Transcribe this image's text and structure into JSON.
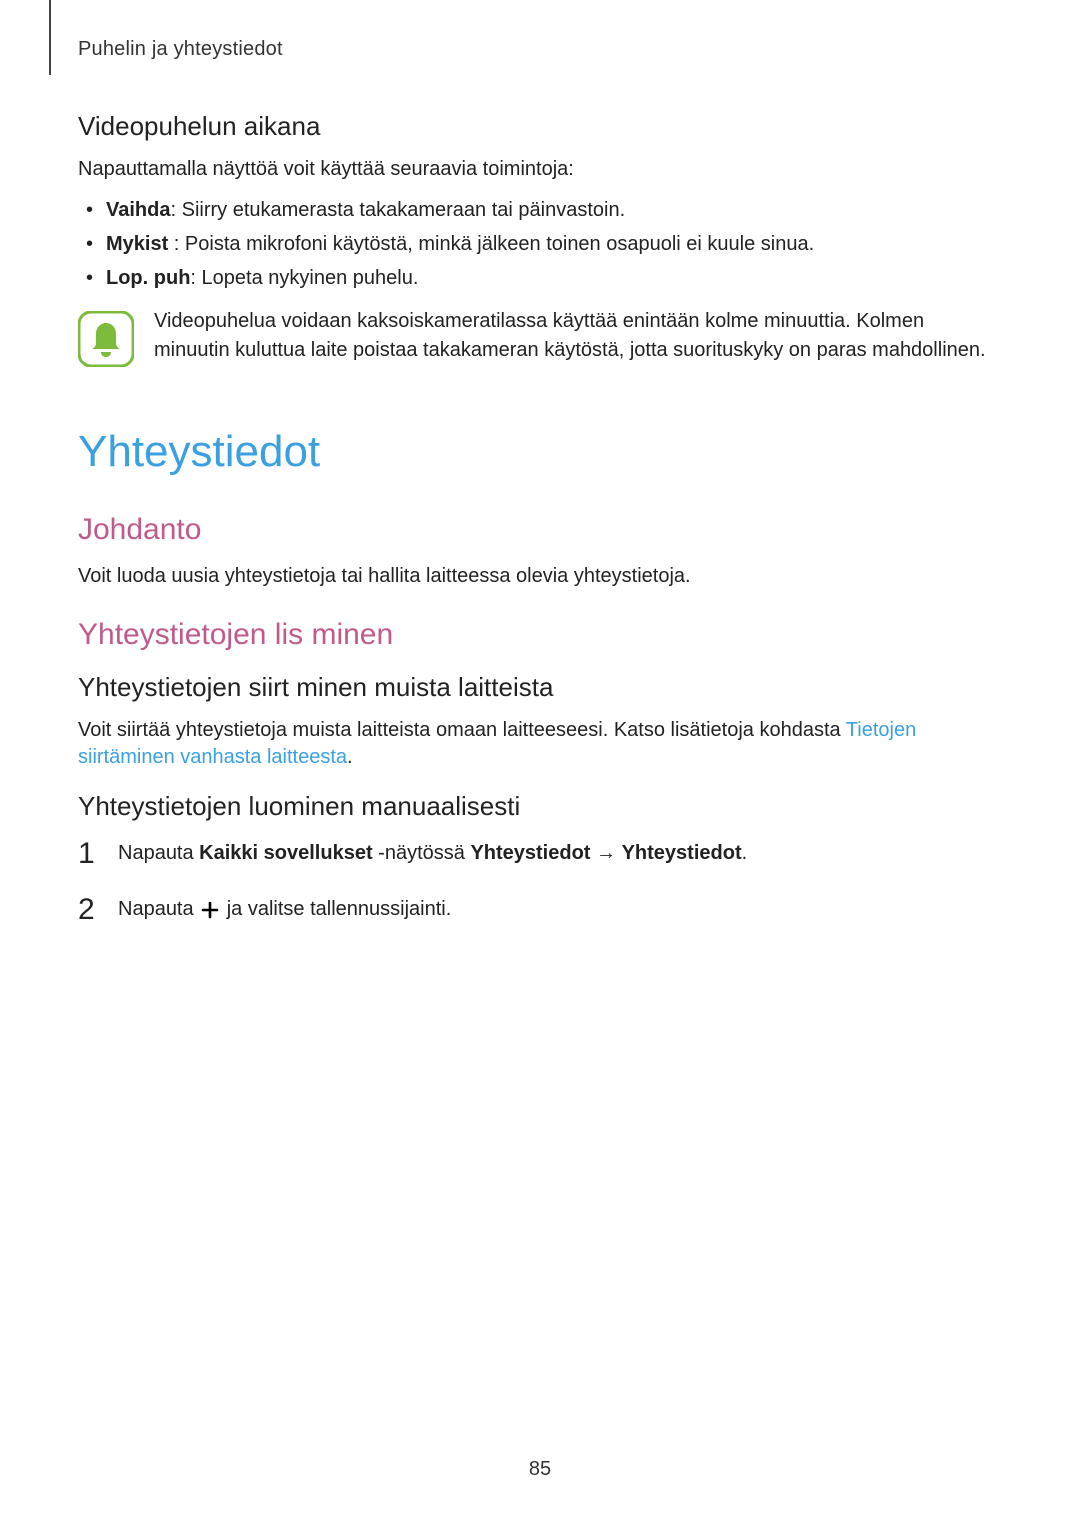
{
  "breadcrumb": "Puhelin ja yhteystiedot",
  "section_video": {
    "heading": "Videopuhelun aikana",
    "intro": "Napauttamalla näyttöä voit käyttää seuraavia toimintoja:",
    "bullets": [
      {
        "label": "Vaihda",
        "rest": ": Siirry etukamerasta takakameraan tai päinvastoin."
      },
      {
        "label": "Mykist",
        "rest": " : Poista mikrofoni käytöstä, minkä jälkeen toinen osapuoli ei kuule sinua."
      },
      {
        "label": "Lop. puh",
        "rest": ": Lopeta nykyinen puhelu."
      }
    ],
    "note": "Videopuhelua voidaan kaksoiskameratilassa käyttää enintään kolme minuuttia. Kolmen minuutin kuluttua laite poistaa takakameran käytöstä, jotta suorituskyky on paras mahdollinen."
  },
  "section_contacts": {
    "title": "Yhteystiedot",
    "intro_heading": "Johdanto",
    "intro_text": "Voit luoda uusia yhteystietoja tai hallita laitteessa olevia yhteystietoja.",
    "add_heading": "Yhteystietojen lis  minen",
    "transfer_heading": "Yhteystietojen siirt minen muista laitteista",
    "transfer_text_pre": "Voit siirtää yhteystietoja muista laitteista omaan laitteeseesi. Katso lisätietoja kohdasta ",
    "transfer_link": "Tietojen siirtäminen vanhasta laitteesta",
    "transfer_text_post": ".",
    "manual_heading": "Yhteystietojen luominen manuaalisesti",
    "steps": {
      "step1_pre": "Napauta ",
      "step1_bold1": "Kaikki sovellukset",
      "step1_mid": " -näytössä ",
      "step1_bold2": "Yhteystiedot",
      "step1_arrow": " → ",
      "step1_bold3": "Yhteystiedot",
      "step1_end": ".",
      "step2_pre": "Napauta ",
      "step2_post": " ja valitse tallennussijainti."
    }
  },
  "page_number": "85",
  "colors": {
    "accent_blue": "#3aa0e0",
    "accent_pink": "#c05a8a",
    "icon_green": "#7dbb3c"
  }
}
